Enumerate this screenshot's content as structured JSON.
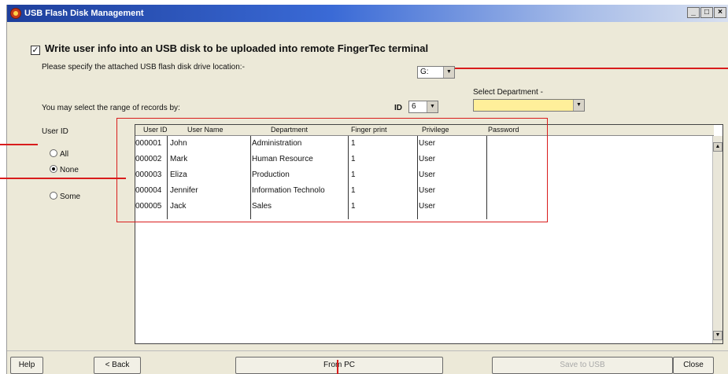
{
  "window": {
    "title": "USB Flash Disk Management",
    "controls": [
      "_",
      "□",
      "×"
    ]
  },
  "write_option": {
    "checked": true,
    "label": "Write user info into an USB disk to be uploaded into remote FingerTec terminal"
  },
  "drive": {
    "prompt": "Please specify the attached USB flash disk drive location:-",
    "value": "G:"
  },
  "range": {
    "prompt": "You may select the range of records by:",
    "id_label": "ID",
    "id_value": "6"
  },
  "department": {
    "label": "Select Department -",
    "value": ""
  },
  "user_id_group": {
    "label": "User ID",
    "options": [
      {
        "label": "All",
        "selected": false
      },
      {
        "label": "None",
        "selected": true
      },
      {
        "label": "Some",
        "selected": false
      }
    ]
  },
  "table": {
    "columns": [
      "User ID",
      "User Name",
      "Department",
      "Finger print",
      "Privilege",
      "Password"
    ],
    "rows": [
      [
        "000001",
        "John",
        "Administration",
        "1",
        "User",
        ""
      ],
      [
        "000002",
        "Mark",
        "Human Resource",
        "1",
        "User",
        ""
      ],
      [
        "000003",
        "Eliza",
        "Production",
        "1",
        "User",
        ""
      ],
      [
        "000004",
        "Jennifer",
        "Information Technolo",
        "1",
        "User",
        ""
      ],
      [
        "000005",
        "Jack",
        "Sales",
        "1",
        "User",
        ""
      ]
    ]
  },
  "buttons": {
    "help": "Help",
    "back": "< Back",
    "from_pc": "From PC",
    "save_to_usb": "Save to USB",
    "close": "Close"
  },
  "colors": {
    "annotation": "#d91c1c",
    "department_combo": "#ffef9a",
    "titlebar": "#1e3f9c"
  }
}
